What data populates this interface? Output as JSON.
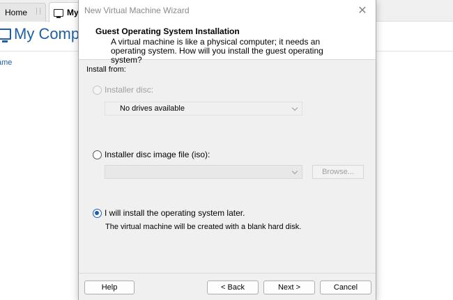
{
  "background": {
    "tabs": [
      {
        "label": "Home"
      },
      {
        "label": "My"
      }
    ],
    "header_title": "My Compu",
    "column_header": "ame"
  },
  "dialog": {
    "title": "New Virtual Machine Wizard",
    "close_glyph": "✕",
    "banner": {
      "heading": "Guest Operating System Installation",
      "description": "A virtual machine is like a physical computer; it needs an operating system. How will you install the guest operating system?"
    },
    "install_from_label": "Install from:",
    "options": {
      "installer_disc": {
        "label": "Installer disc:",
        "selected": false,
        "enabled": false,
        "dropdown_value": "No drives available"
      },
      "iso": {
        "label": "Installer disc image file (iso):",
        "selected": false,
        "enabled": true,
        "path_value": "",
        "browse_label": "Browse..."
      },
      "later": {
        "label": "I will install the operating system later.",
        "selected": true,
        "note": "The virtual machine will be created with a blank hard disk."
      }
    },
    "buttons": {
      "help": "Help",
      "back": "< Back",
      "next": "Next >",
      "cancel": "Cancel"
    }
  },
  "colors": {
    "accent": "#1a5fb4",
    "link_blue": "#1f5fa8",
    "dialog_bg": "#f0f0f0"
  }
}
